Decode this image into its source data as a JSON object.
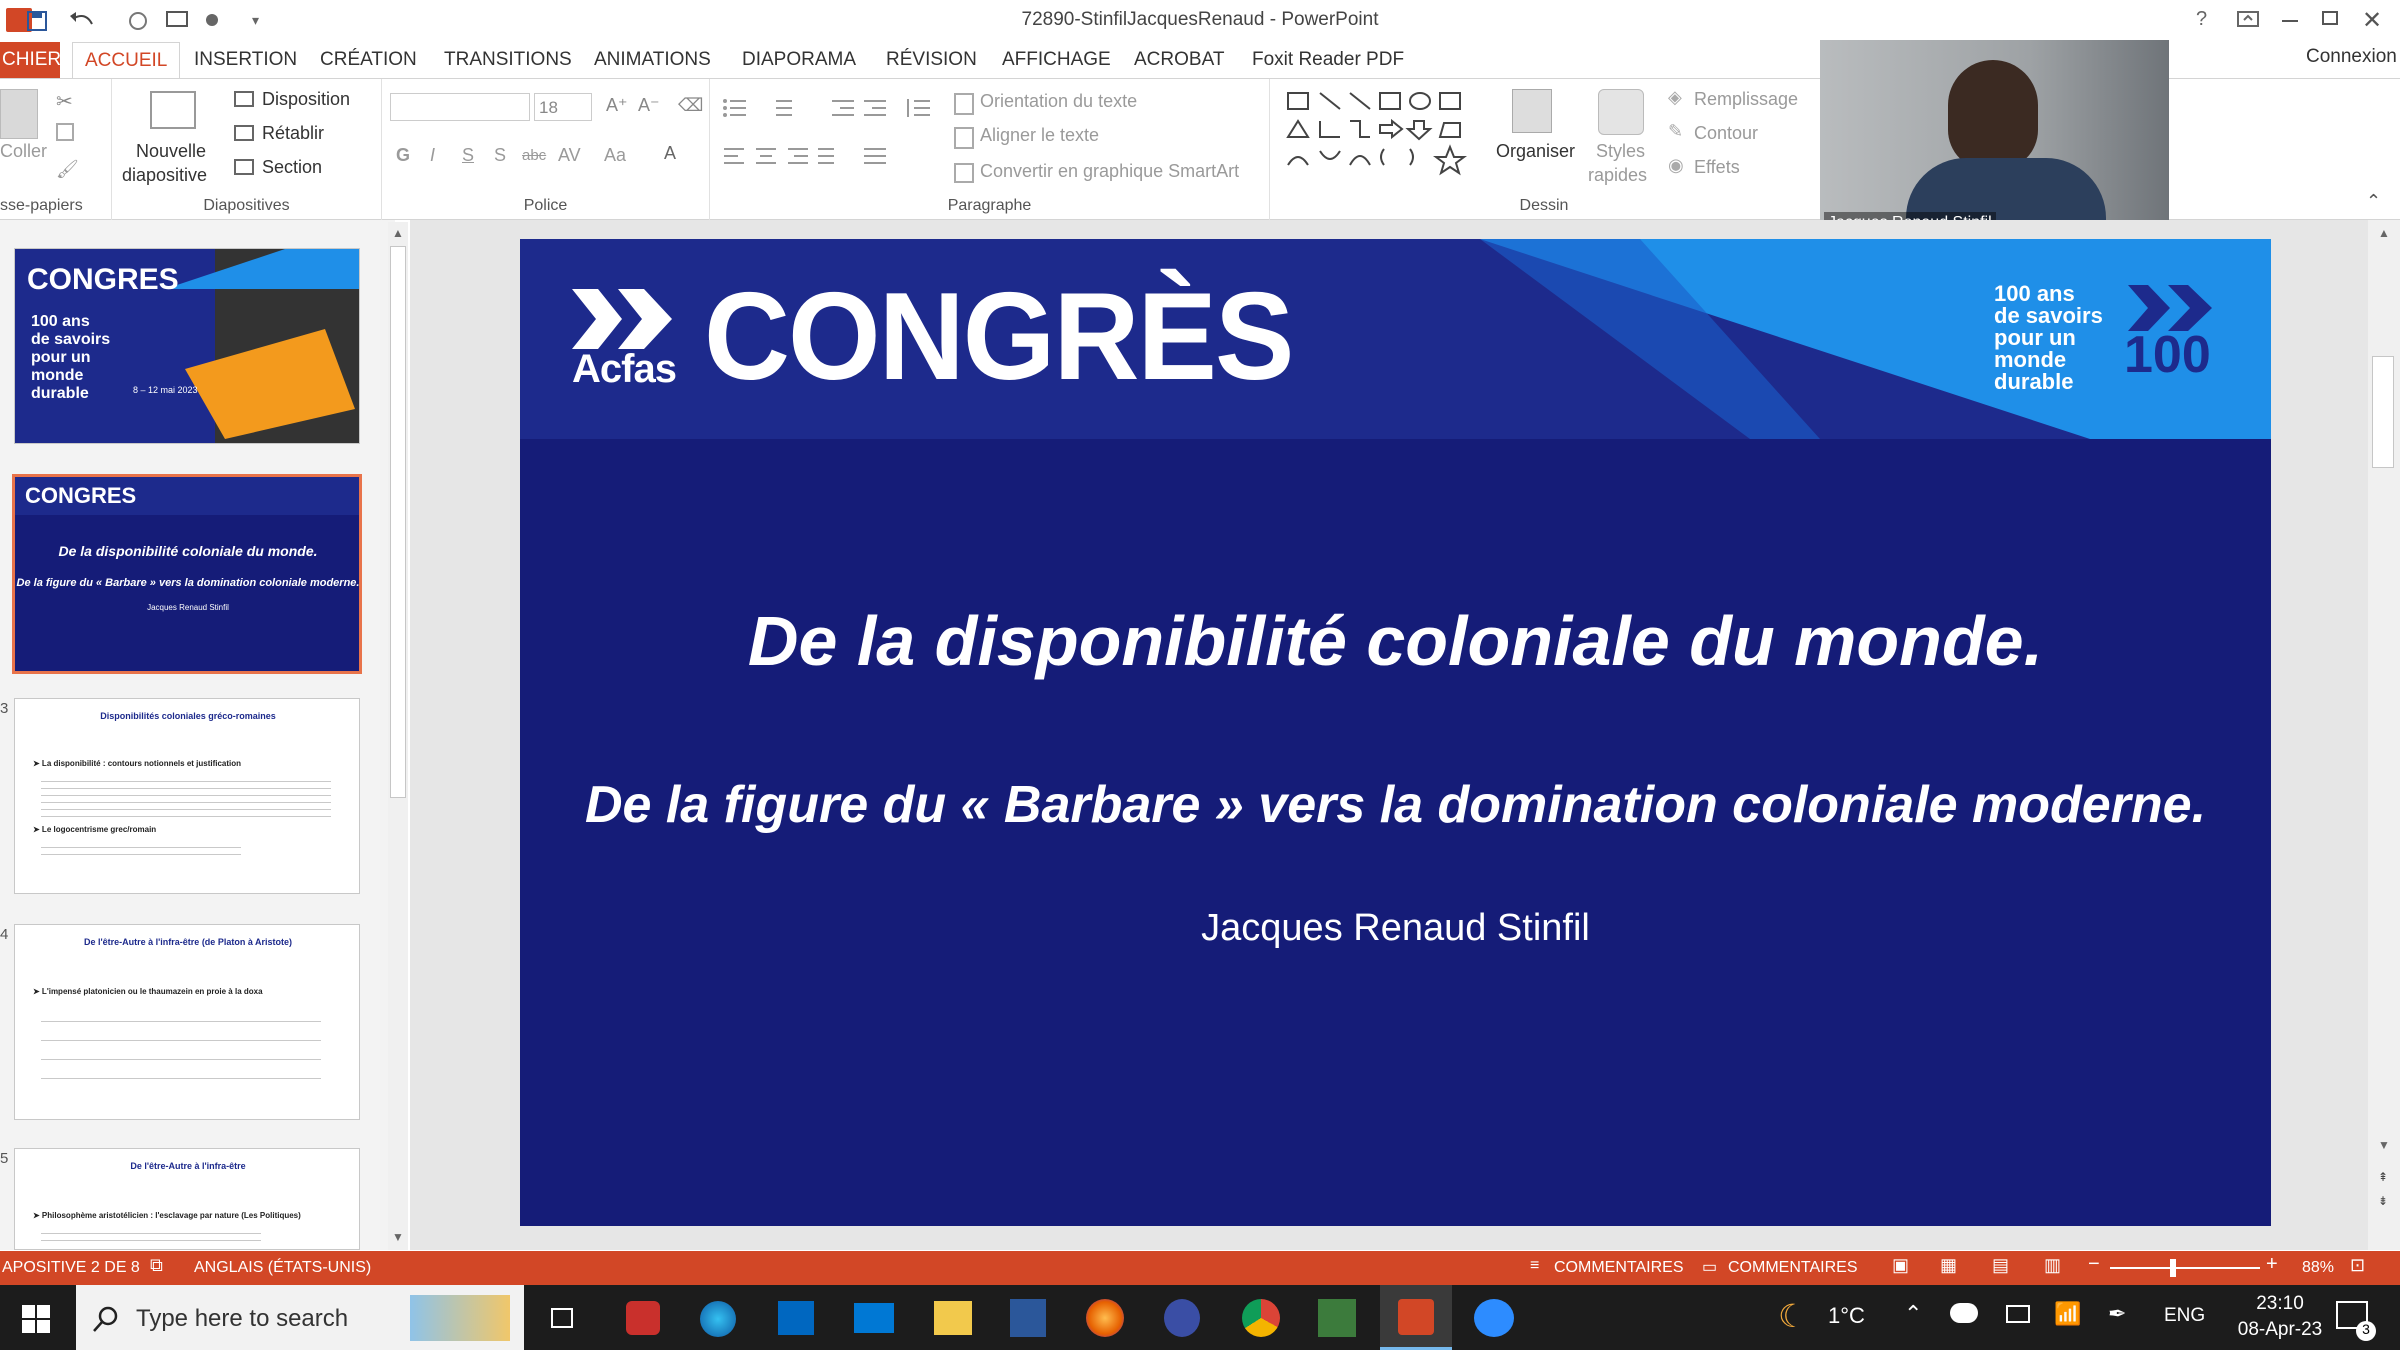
{
  "window": {
    "title": "72890-StinfilJacquesRenaud - PowerPoint",
    "help": "?",
    "signin": "Connexion"
  },
  "tabs": [
    {
      "label": "CHIER",
      "type": "file"
    },
    {
      "label": "ACCUEIL",
      "type": "active"
    },
    {
      "label": "INSERTION"
    },
    {
      "label": "CRÉATION"
    },
    {
      "label": "TRANSITIONS"
    },
    {
      "label": "ANIMATIONS"
    },
    {
      "label": "DIAPORAMA"
    },
    {
      "label": "RÉVISION"
    },
    {
      "label": "AFFICHAGE"
    },
    {
      "label": "ACROBAT"
    },
    {
      "label": "Foxit Reader PDF"
    }
  ],
  "ribbon": {
    "clipboard": {
      "paste": "Coller",
      "label": "sse-papiers"
    },
    "slides": {
      "new_slide_1": "Nouvelle",
      "new_slide_2": "diapositive",
      "layout": "Disposition",
      "reset": "Rétablir",
      "section": "Section",
      "label": "Diapositives"
    },
    "font": {
      "size": "18",
      "label": "Police",
      "bold": "G",
      "italic": "I",
      "underline": "S",
      "shadow": "S",
      "strike": "abc",
      "spacing": "AV",
      "case": "Aa",
      "color": "A"
    },
    "paragraph": {
      "orientation": "Orientation du texte",
      "align": "Aligner le texte",
      "smartart": "Convertir en graphique SmartArt",
      "label": "Paragraphe"
    },
    "drawing": {
      "arrange": "Organiser",
      "styles_1": "Styles",
      "styles_2": "rapides",
      "fill": "Remplissage",
      "outline": "Contour",
      "effects": "Effets",
      "label": "Dessin"
    }
  },
  "webcam": {
    "name": "Jacques Renaud Stinfil"
  },
  "thumbnails": [
    {
      "num": "",
      "brand": "CONGRES",
      "lines": [
        "100 ans",
        "de savoirs",
        "pour un",
        "monde",
        "durable"
      ],
      "dates": "8 – 12 mai 2023"
    },
    {
      "num": "",
      "brand": "CONGRES",
      "title": "De la disponibilité coloniale du monde.",
      "subtitle": "De la figure du « Barbare » vers la domination coloniale moderne.",
      "author": "Jacques Renaud Stinfil"
    },
    {
      "num": "3",
      "title": "Disponibilités coloniales gréco-romaines",
      "b1": "➤ La disponibilité : contours notionnels et justification",
      "b2": "➤ Le logocentrisme grec/romain"
    },
    {
      "num": "4",
      "title": "De l'être-Autre à l'infra-être (de Platon à Aristote)",
      "b1": "➤ L'impensé platonicien ou le thaumazein en proie à la doxa"
    },
    {
      "num": "5",
      "title": "De l'être-Autre à l'infra-être",
      "b1": "➤ Philosophème aristotélicien : l'esclavage par nature (Les Politiques)"
    }
  ],
  "slide": {
    "logo_org": "Acfas",
    "logo_word": "CONGRÈS",
    "tagline": [
      "100 ans",
      "de savoirs",
      "pour un",
      "monde",
      "durable"
    ],
    "badge": "100",
    "title": "De la disponibilité coloniale du monde.",
    "subtitle": "De la figure du « Barbare » vers la domination coloniale moderne.",
    "author": "Jacques Renaud Stinfil"
  },
  "status": {
    "slide_pos": "APOSITIVE 2 DE 8",
    "language": "ANGLAIS (ÉTATS-UNIS)",
    "notes": "COMMENTAIRES",
    "comments": "COMMENTAIRES",
    "zoom": "88%"
  },
  "taskbar": {
    "search": "Type here to search",
    "weather": "1°C",
    "lang": "ENG",
    "time": "23:10",
    "date": "08-Apr-23",
    "notif": "3"
  },
  "colors": {
    "accent": "#d24726",
    "slide_bg": "#151c78",
    "band": "#1d2a8c",
    "bright_blue": "#1f8fe8"
  }
}
